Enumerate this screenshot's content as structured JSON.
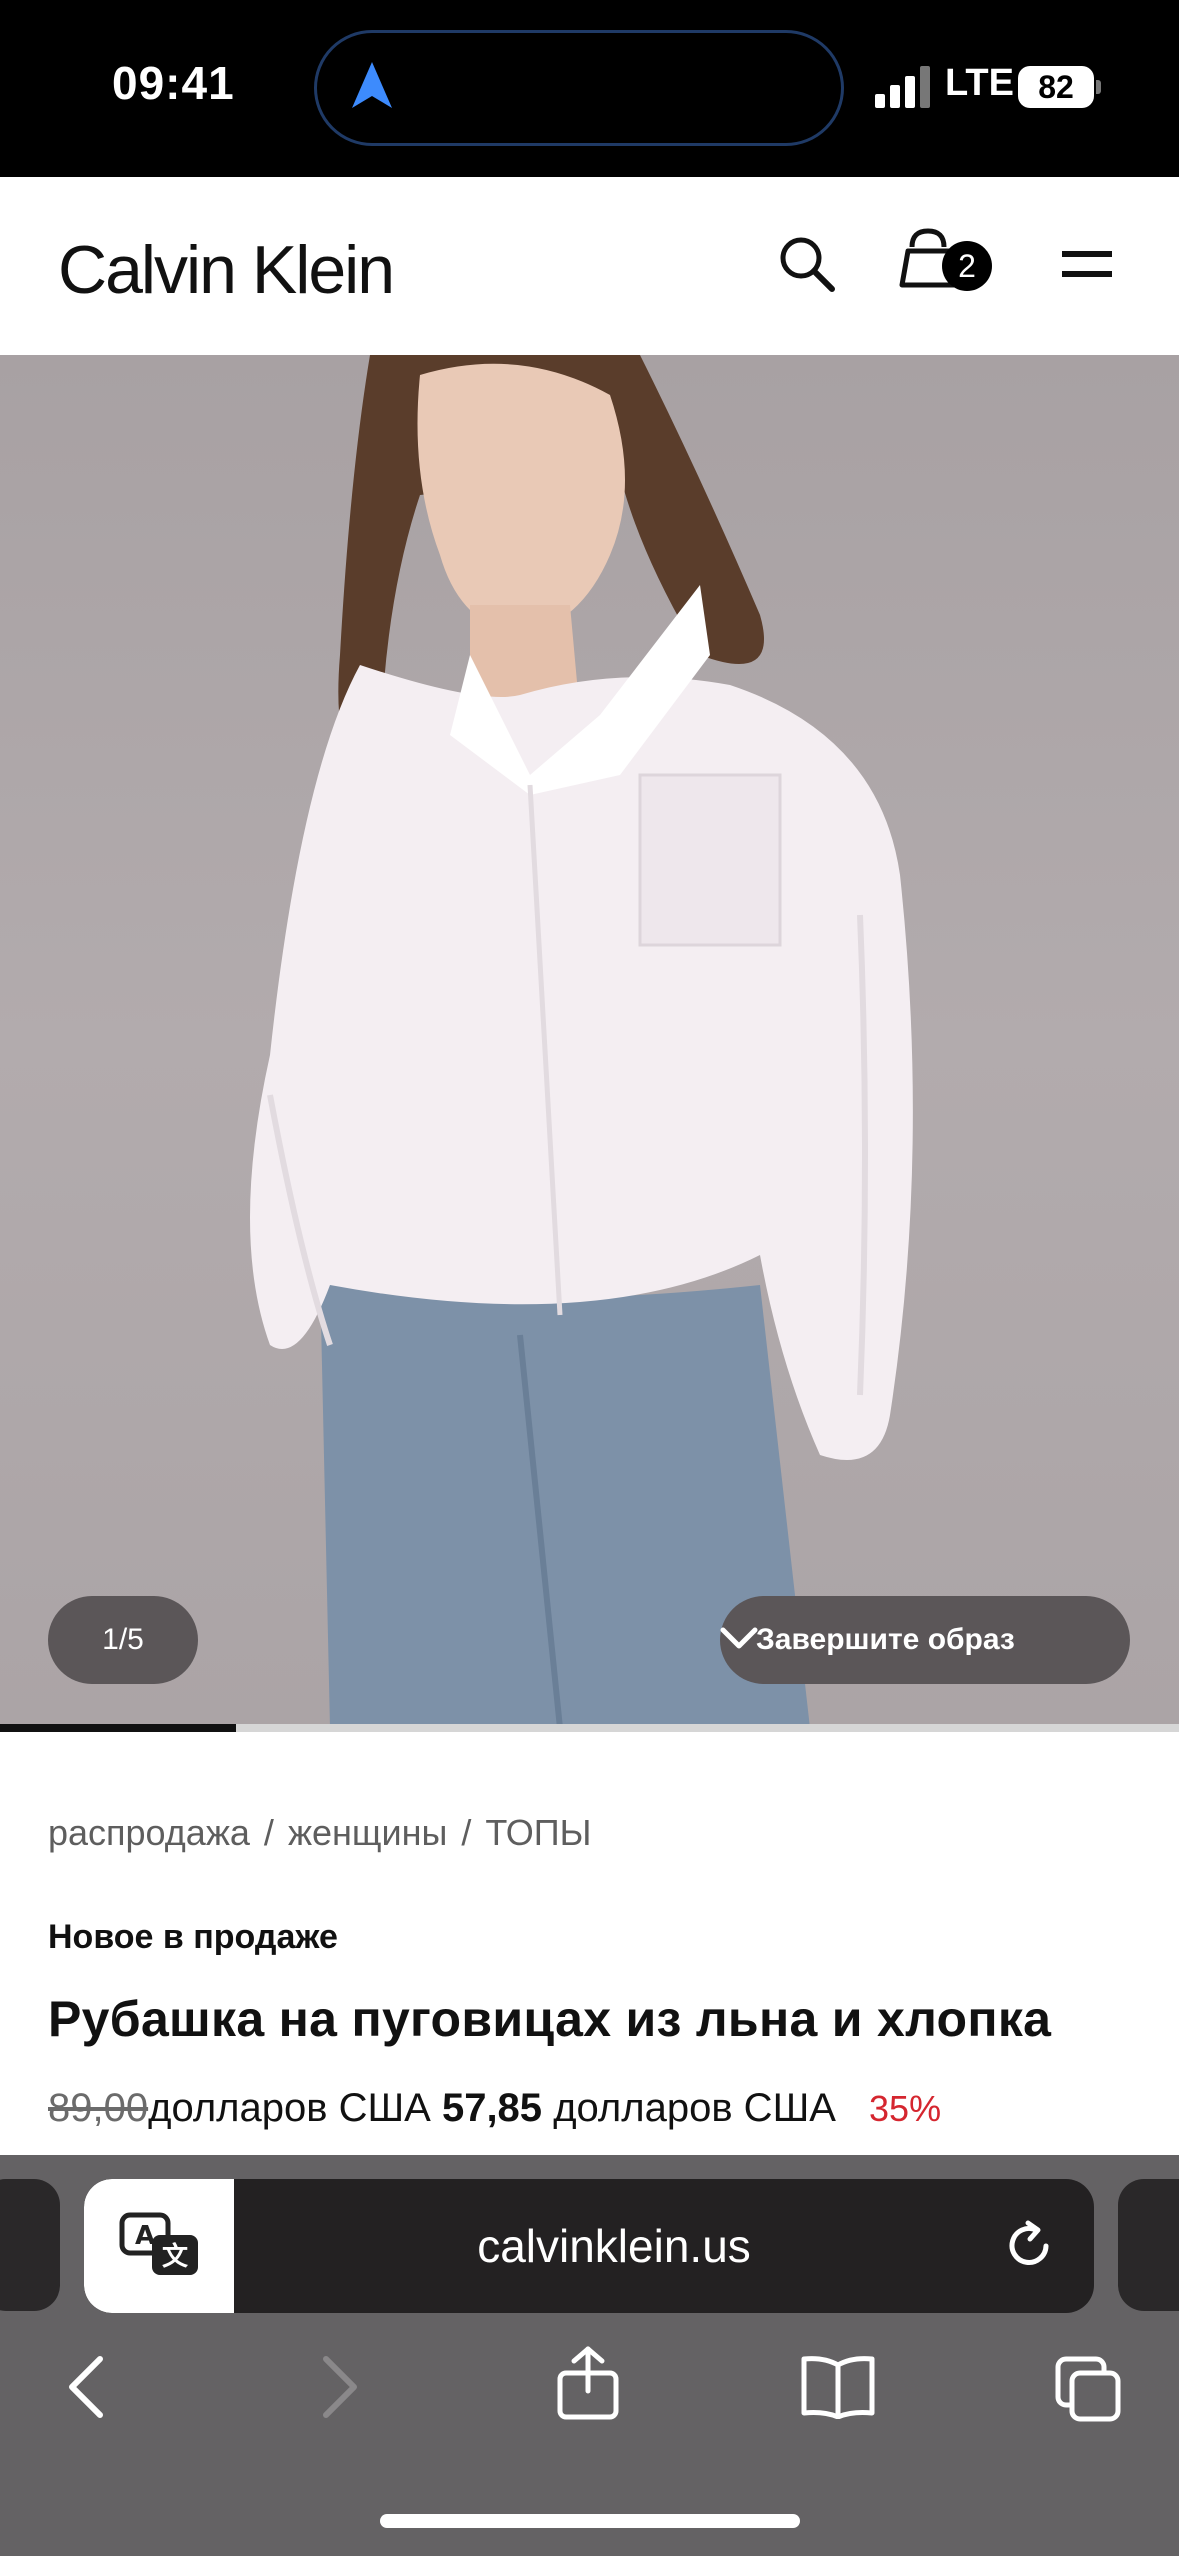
{
  "status_bar": {
    "time": "09:41",
    "network": "LTE",
    "battery": "82"
  },
  "header": {
    "logo": "Calvin Klein",
    "cart_count": "2"
  },
  "gallery": {
    "pager": "1/5",
    "complete_look_label": "Завершите образ",
    "progress": 0.2
  },
  "product": {
    "breadcrumb": [
      "распродажа",
      "женщины",
      "ТОПЫ"
    ],
    "breadcrumb_separator": "/",
    "badge": "Новое в продаже",
    "title": "Рубашка на пуговицах из льна и хлопка",
    "old_price": "89,00",
    "old_price_suffix": "долларов США",
    "new_price": "57,85",
    "new_price_suffix": "долларов США",
    "discount": "35%"
  },
  "browser": {
    "url": "calvinklein.us"
  },
  "colors": {
    "accent_red": "#d5262f",
    "island_border": "#1f3a66",
    "nav_arrow": "#3d8bfd"
  }
}
